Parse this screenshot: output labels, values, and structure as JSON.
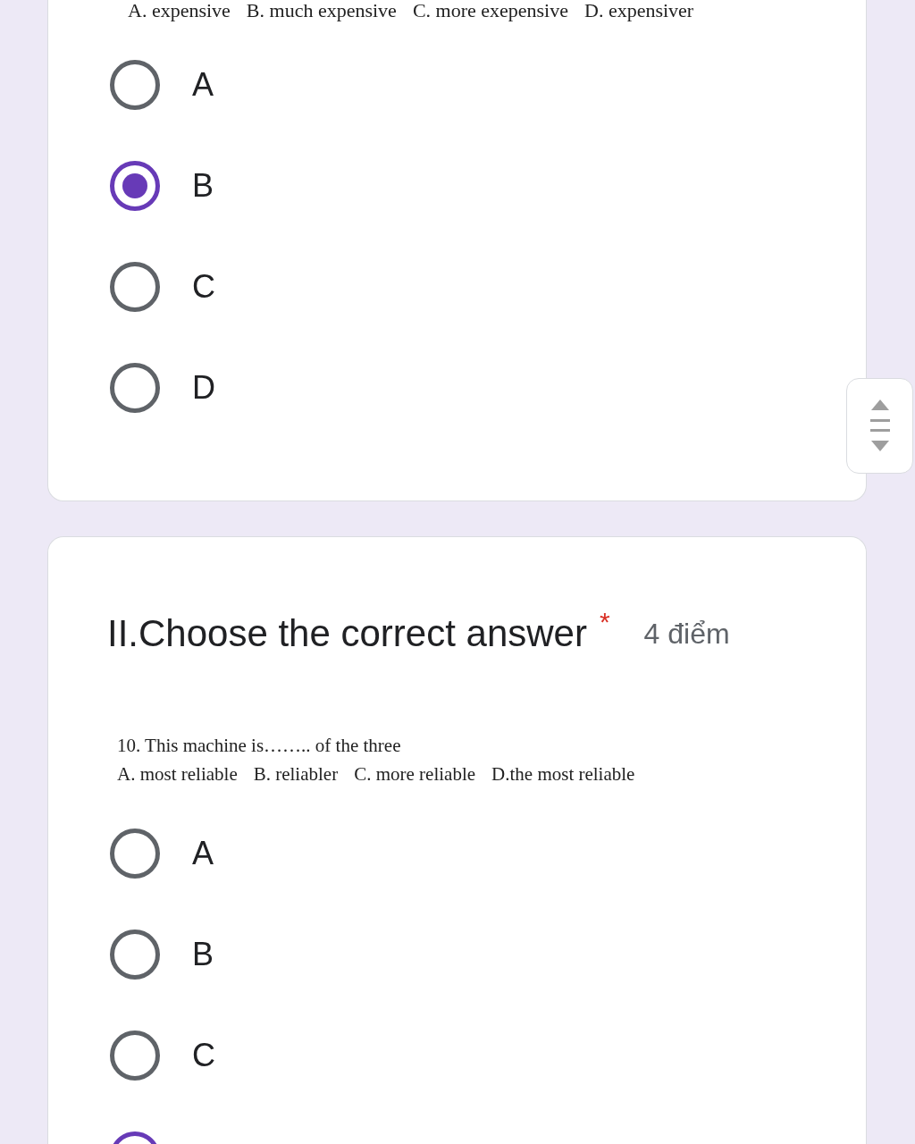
{
  "question_1": {
    "choices": [
      "A. expensive",
      "B. much expensive",
      "C. more exepensive",
      "D. expensiver"
    ],
    "options": [
      {
        "label": "A",
        "selected": false
      },
      {
        "label": "B",
        "selected": true
      },
      {
        "label": "C",
        "selected": false
      },
      {
        "label": "D",
        "selected": false
      }
    ]
  },
  "question_2": {
    "title": "II.Choose the correct answer",
    "required_mark": "*",
    "points": "4 điểm",
    "prompt": "10. This machine is…….. of the three",
    "choices": [
      "A. most reliable",
      "B. reliabler",
      "C. more reliable",
      "D.the most reliable"
    ],
    "options": [
      {
        "label": "A",
        "selected": false
      },
      {
        "label": "B",
        "selected": false
      },
      {
        "label": "C",
        "selected": false
      },
      {
        "selected": true
      }
    ]
  }
}
